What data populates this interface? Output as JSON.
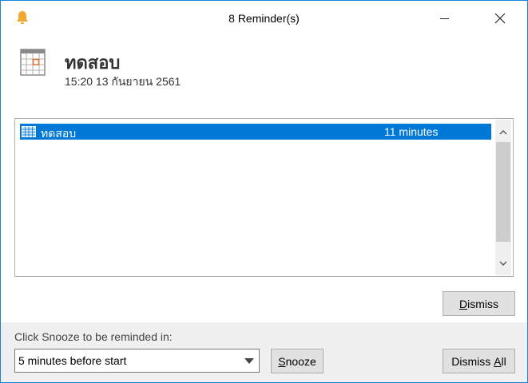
{
  "window": {
    "title": "8 Reminder(s)",
    "close_glyph": "✕"
  },
  "header": {
    "subject": "ทดสอบ",
    "datetime": "15:20 13 กันยายน 2561"
  },
  "list": {
    "items": [
      {
        "subject": "ทดสอบ",
        "due": "11 minutes"
      }
    ]
  },
  "buttons": {
    "dismiss_pre": "",
    "dismiss_acc": "D",
    "dismiss_post": "ismiss",
    "snooze_pre": "",
    "snooze_acc": "S",
    "snooze_post": "nooze",
    "dismiss_all_pre": "Dismiss ",
    "dismiss_all_acc": "A",
    "dismiss_all_post": "ll"
  },
  "footer": {
    "snooze_label": "Click Snooze to be reminded in:",
    "snooze_selected": "5 minutes before start"
  },
  "colors": {
    "accent": "#0078d7",
    "border": "#1883d7",
    "bell": "#f0a830",
    "calendar_orange": "#e07030"
  }
}
